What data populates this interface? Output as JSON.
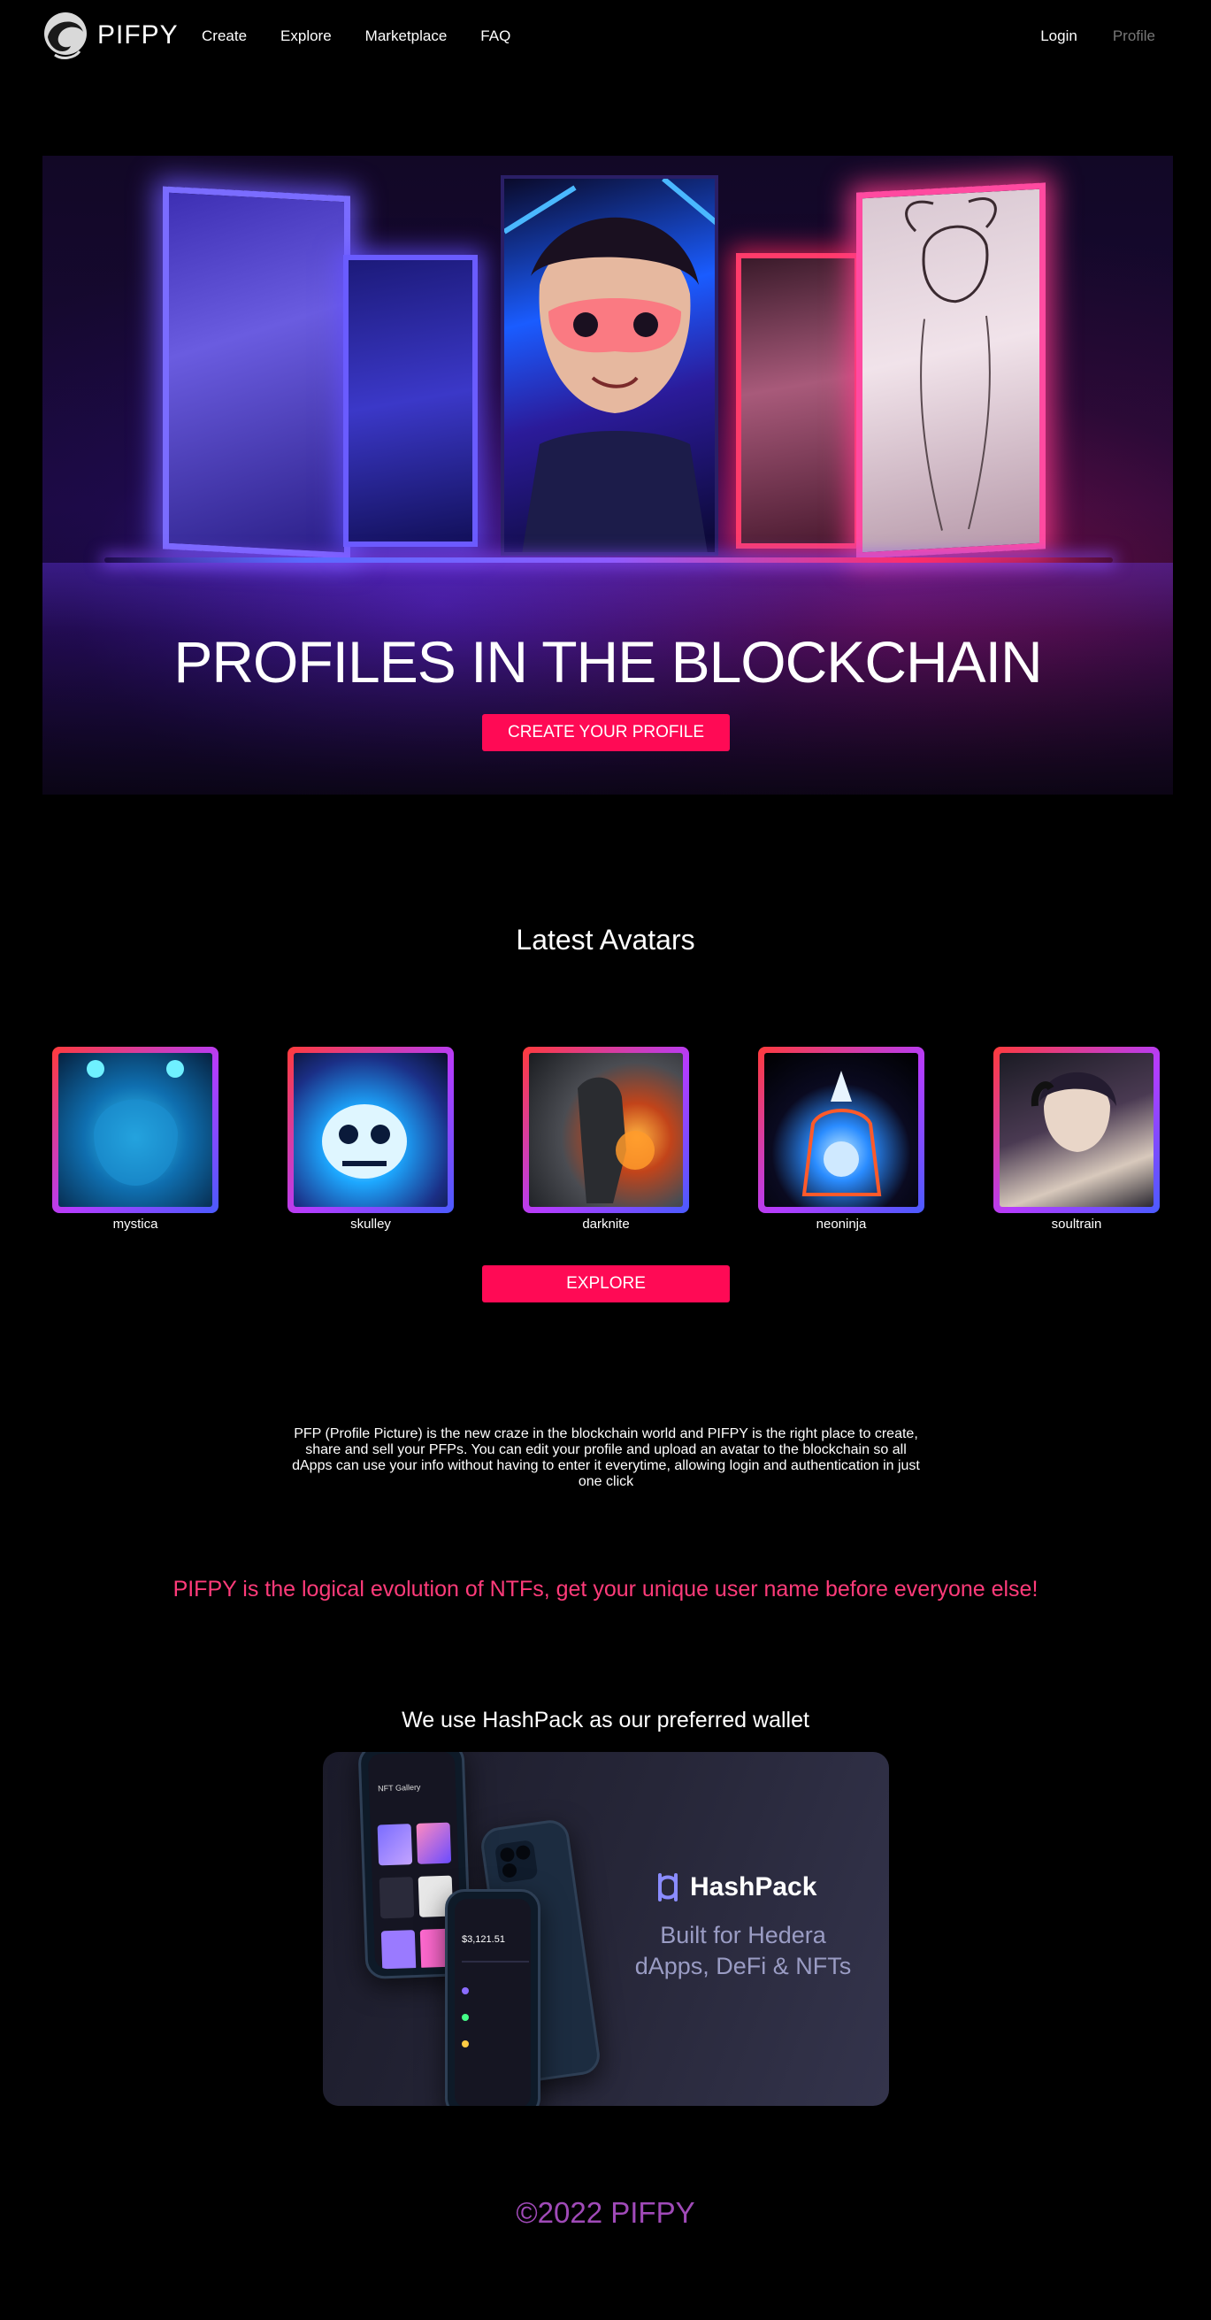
{
  "nav": {
    "brand": "PIFPY",
    "links": [
      "Create",
      "Explore",
      "Marketplace",
      "FAQ"
    ],
    "login": "Login",
    "profile": "Profile"
  },
  "hero": {
    "title": "PROFILES IN THE BLOCKCHAIN",
    "cta": "CREATE YOUR PROFILE"
  },
  "latest": {
    "title": "Latest Avatars",
    "avatars": [
      "mystica",
      "skulley",
      "darknite",
      "neoninja",
      "soultrain"
    ],
    "explore": "EXPLORE"
  },
  "about": {
    "text": "PFP (Profile Picture) is the new craze in the blockchain world and PIFPY is the right place to create, share and sell your PFPs. You can edit your profile and upload an avatar to the blockchain so all dApps can use your info without having to enter it everytime, allowing login and authentication in just one click",
    "tagline": "PIFPY is the logical evolution of NTFs, get your unique user name before everyone else!"
  },
  "wallet": {
    "title": "We use HashPack as our preferred wallet",
    "brand": "HashPack",
    "subtitle_line1": "Built for Hedera",
    "subtitle_line2": "dApps, DeFi & NFTs",
    "phone_header": "NFT Gallery",
    "phone_balance": "$3,121.51"
  },
  "footer": {
    "copyright": "©2022 PIFPY"
  },
  "colors": {
    "accent": "#ff0a55",
    "tagline": "#ff3b7a",
    "footer": "#a04ab8",
    "background": "#000000"
  }
}
